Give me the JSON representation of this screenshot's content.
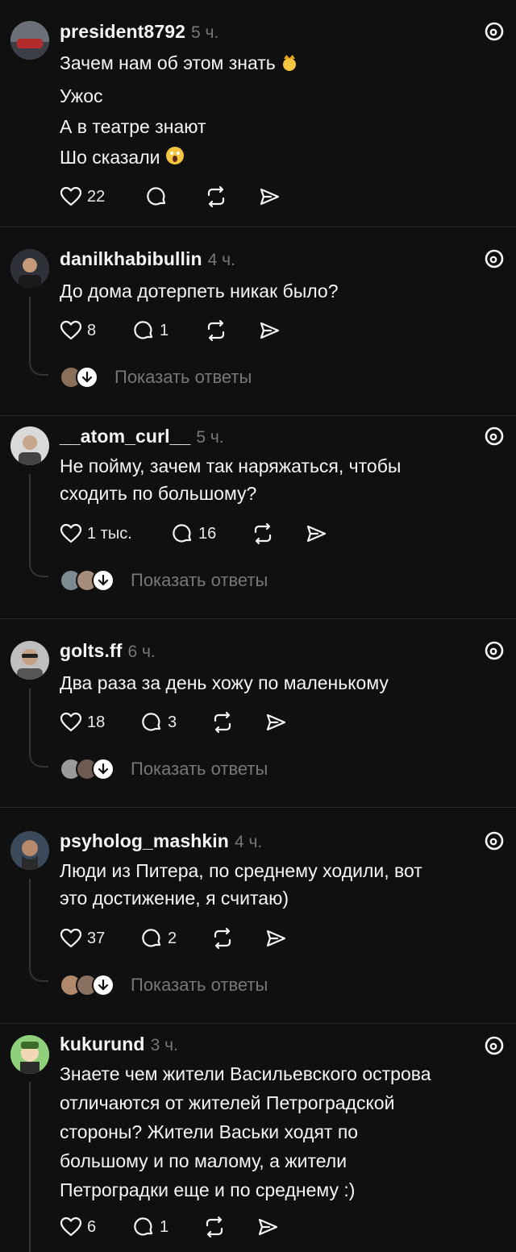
{
  "posts": [
    {
      "username": "president8792",
      "time": "5 ч.",
      "lines": [
        "Зачем нам об этом знать",
        "Ужос",
        "А в театре знают",
        "Шо сказали"
      ],
      "likes": "22",
      "comments": "",
      "show_replies": ""
    },
    {
      "username": "danilkhabibullin",
      "time": "4 ч.",
      "lines": [
        "До дома дотерпеть никак было?"
      ],
      "likes": "8",
      "comments": "1",
      "show_replies": "Показать ответы"
    },
    {
      "username": "__atom_curl__",
      "time": "5 ч.",
      "lines": [
        "Не пойму, зачем так наряжаться, чтобы",
        "сходить по большому?"
      ],
      "likes": "1 тыс.",
      "comments": "16",
      "show_replies": "Показать ответы"
    },
    {
      "username": "golts.ff",
      "time": "6 ч.",
      "lines": [
        "Два раза за день хожу по маленькому"
      ],
      "likes": "18",
      "comments": "3",
      "show_replies": "Показать ответы"
    },
    {
      "username": "psyholog_mashkin",
      "time": "4 ч.",
      "lines": [
        "Люди из Питера, по среднему ходили, вот",
        "это достижение, я считаю)"
      ],
      "likes": "37",
      "comments": "2",
      "show_replies": "Показать ответы"
    },
    {
      "username": "kukurund",
      "time": "3 ч.",
      "lines": [
        "Знаете чем жители Васильевского острова",
        "отличаются от жителей Петроградской",
        "стороны? Жители Васьки ходят по",
        "большому и по малому, а жители",
        "Петроградки еще и по среднему :)"
      ],
      "likes": "6",
      "comments": "1",
      "show_replies": ""
    }
  ],
  "icons": {
    "like": "heart-icon",
    "comment": "comment-icon",
    "repost": "repost-icon",
    "share": "share-icon",
    "threads": "threads-logo-icon"
  }
}
